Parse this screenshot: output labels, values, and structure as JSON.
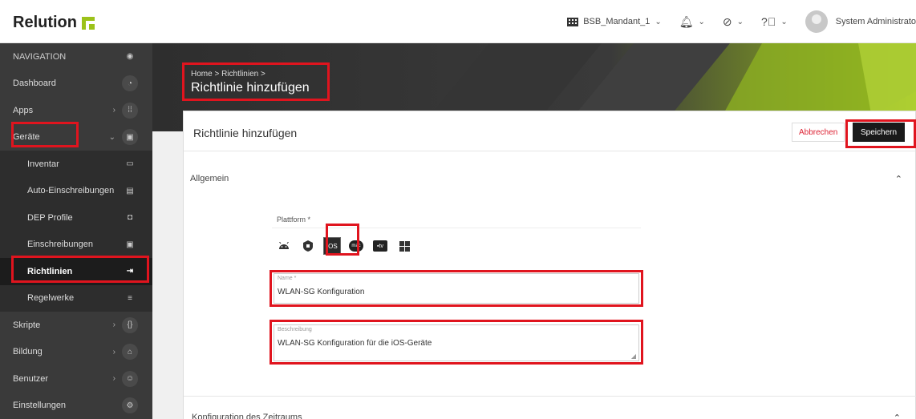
{
  "header": {
    "logo_text": "Relution",
    "tenant": "BSB_Mandant_1",
    "user": "System Administrato"
  },
  "sidebar": {
    "header": "NAVIGATION",
    "items": [
      {
        "label": "Dashboard",
        "icon": "dashboard-icon"
      },
      {
        "label": "Apps",
        "icon": "apps-grid-icon",
        "arrow": "›"
      },
      {
        "label": "Geräte",
        "icon": "devices-icon",
        "arrow": "⌄"
      },
      {
        "label": "Inventar",
        "icon": "inventory-icon"
      },
      {
        "label": "Auto-Einschreibungen",
        "icon": "auto-enroll-icon"
      },
      {
        "label": "DEP Profile",
        "icon": "dep-icon"
      },
      {
        "label": "Einschreibungen",
        "icon": "enroll-icon"
      },
      {
        "label": "Richtlinien",
        "icon": "policy-icon"
      },
      {
        "label": "Regelwerke",
        "icon": "rules-icon"
      },
      {
        "label": "Skripte",
        "icon": "scripts-icon",
        "arrow": "›"
      },
      {
        "label": "Bildung",
        "icon": "education-icon",
        "arrow": "›"
      },
      {
        "label": "Benutzer",
        "icon": "users-icon",
        "arrow": "›"
      },
      {
        "label": "Einstellungen",
        "icon": "settings-icon"
      }
    ]
  },
  "banner": {
    "breadcrumb": "Home > Richtlinien >",
    "title": "Richtlinie hinzufügen"
  },
  "card": {
    "title": "Richtlinie hinzufügen",
    "cancel_label": "Abbrechen",
    "save_label": "Speichern",
    "section_general": "Allgemein",
    "platform_label": "Plattform *",
    "platforms": [
      "android",
      "android-enterprise",
      "iOS",
      "mac",
      "tv",
      "windows"
    ],
    "selected_platform": "iOS",
    "name_label": "Name *",
    "name_value": "WLAN-SG Konfiguration",
    "desc_label": "Beschreibung",
    "desc_value": "WLAN-SG Konfiguration für die iOS-Geräte",
    "section_time": "Konfiguration des Zeitraums"
  },
  "colors": {
    "accent": "#9cc21a",
    "highlight": "#e0141e",
    "sidebar_bg": "#3a3a3a"
  }
}
